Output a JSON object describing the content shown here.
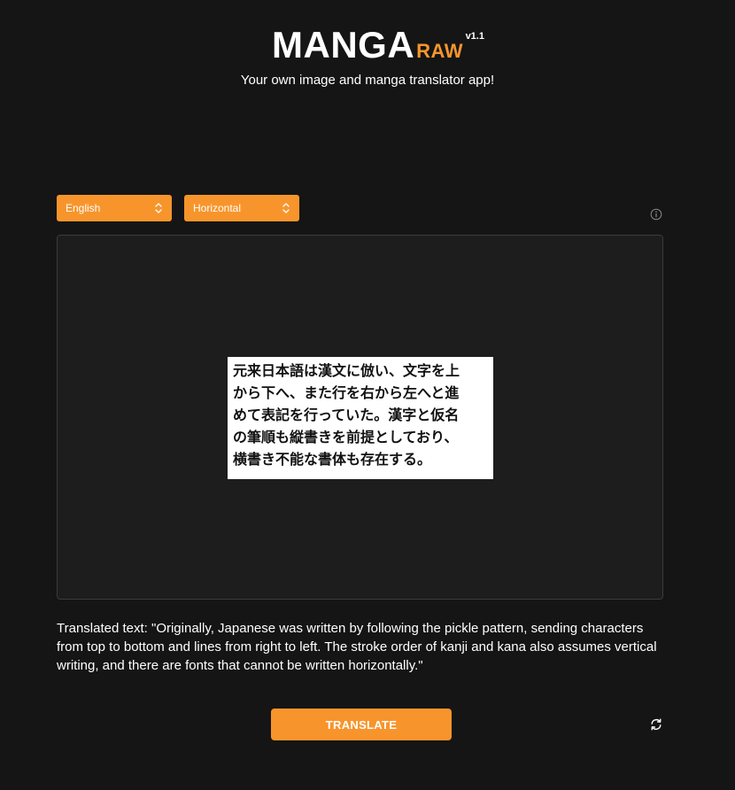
{
  "header": {
    "brand_main": "MANGA",
    "brand_sub": "RAW",
    "version": "v1.1",
    "tagline": "Your own image and manga translator app!"
  },
  "controls": {
    "language": {
      "selected": "English",
      "icon": "chevron-up-down-icon"
    },
    "direction": {
      "selected": "Horizontal",
      "icon": "chevron-up-down-icon"
    },
    "info_icon": "info-circle-icon"
  },
  "image_panel": {
    "source_lines": [
      "元来日本語は漢文に倣い、文字を上",
      "から下へ、また行を右から左へと進",
      "めて表記を行っていた。漢字と仮名",
      "の筆順も縦書きを前提としており、",
      "横書き不能な書体も存在する。"
    ]
  },
  "translation": {
    "text": "Translated text: \"Originally, Japanese was written by following the pickle pattern, sending characters from top to bottom and lines from right to left. The stroke order of kanji and kana also assumes vertical writing, and there are fonts that cannot be written horizontally.\""
  },
  "actions": {
    "translate_label": "TRANSLATE",
    "refresh_icon": "refresh-icon"
  },
  "colors": {
    "background": "#151515",
    "accent": "#f7952c",
    "panel": "#1d1d1d",
    "text": "#ffffff"
  }
}
